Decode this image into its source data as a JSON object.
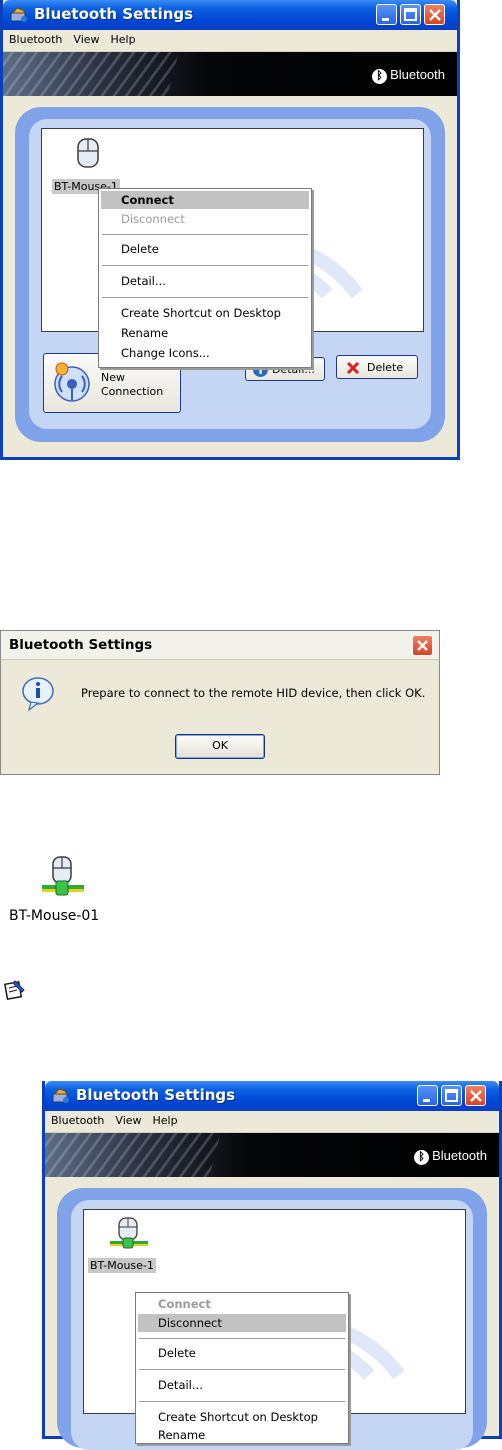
{
  "window": {
    "title": "Bluetooth Settings",
    "menu": [
      "Bluetooth",
      "View",
      "Help"
    ],
    "brand": "Bluetooth",
    "device_label": "BT-Mouse-1",
    "new_connection_line1": "New",
    "new_connection_line2": "Connection",
    "detail_button": "Detail...",
    "delete_button": "Delete"
  },
  "context_menu_1": {
    "items": [
      "Connect",
      "Disconnect",
      "Delete",
      "Detail...",
      "Create Shortcut on Desktop",
      "Rename",
      "Change Icons..."
    ],
    "selected": "Connect",
    "disabled": "Disconnect"
  },
  "dialog": {
    "title": "Bluetooth Settings",
    "message": "Prepare to connect to the remote HID device, then click OK.",
    "ok_label": "OK"
  },
  "connected_device_label": "BT-Mouse-01",
  "window2": {
    "title": "Bluetooth Settings",
    "menu": [
      "Bluetooth",
      "View",
      "Help"
    ],
    "brand": "Bluetooth",
    "device_label": "BT-Mouse-1"
  },
  "context_menu_2": {
    "items": [
      "Connect",
      "Disconnect",
      "Delete",
      "Detail...",
      "Create Shortcut on Desktop",
      "Rename"
    ],
    "selected": "Disconnect",
    "disabled": "Connect"
  },
  "colors": {
    "titlebar": "#0046d5",
    "panel_outer": "#7fa2e8",
    "panel_inner": "#c5d5f4",
    "menu_highlight": "#c2c2c2"
  }
}
